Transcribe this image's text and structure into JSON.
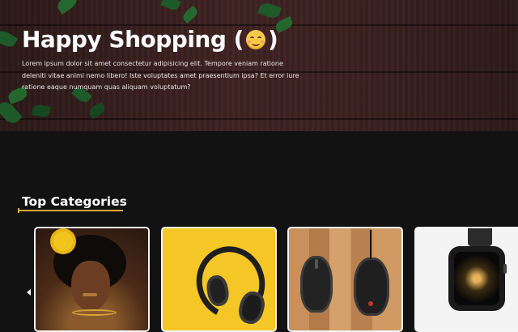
{
  "hero": {
    "title": "Happy Shopping (",
    "title_end": ")",
    "emoji_icon": "smiling-face-icon",
    "description": "Lorem ipsum dolor sit amet consectetur adipisicing elit. Tempore veniam ratione deleniti vitae animi nemo libero! Iste voluptates amet praesentium ipsa? Et error iure ratione eaque numquam quas aliquam voluptatum?"
  },
  "categories": {
    "title": "Top Categories",
    "accent_color": "#e8a33d",
    "prev_icon": "chevron-left-icon",
    "items": [
      {
        "image": "woman-with-yellow-flower"
      },
      {
        "image": "headphones-on-yellow"
      },
      {
        "image": "computer-mice-on-wood"
      },
      {
        "image": "smartwatch"
      }
    ]
  }
}
